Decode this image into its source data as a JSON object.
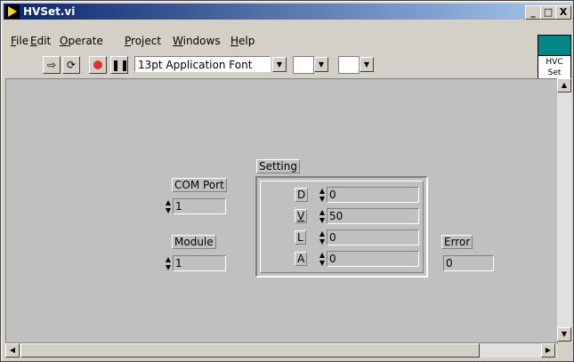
{
  "window": {
    "title": "HVSet.vi",
    "minimize": "_",
    "maximize": "□",
    "close": "X"
  },
  "menu": {
    "items": [
      {
        "underline": "F",
        "rest": "ile"
      },
      {
        "underline": "E",
        "rest": "dit"
      },
      {
        "underline": "O",
        "rest": "perate"
      },
      {
        "underline": "P",
        "rest": "roject"
      },
      {
        "underline": "W",
        "rest": "indows"
      },
      {
        "underline": "H",
        "rest": "elp"
      }
    ]
  },
  "toolbar": {
    "font": "13pt Application Font"
  },
  "vi_icon": {
    "line1": "HVC",
    "line2": "Set"
  },
  "panel": {
    "com_port": {
      "label": "COM Port",
      "value": "1"
    },
    "module": {
      "label": "Module",
      "value": "1"
    },
    "setting": {
      "label": "Setting",
      "rows": [
        {
          "label": "D",
          "value": "0"
        },
        {
          "label": "V",
          "value": "50"
        },
        {
          "label": "L",
          "value": "0"
        },
        {
          "label": "A",
          "value": "0"
        }
      ]
    },
    "error": {
      "label": "Error",
      "value": "0"
    }
  },
  "icons": {
    "run": "run-arrow-icon",
    "run_continuous": "run-continuously-icon",
    "abort": "abort-icon",
    "pause": "pause-icon"
  }
}
